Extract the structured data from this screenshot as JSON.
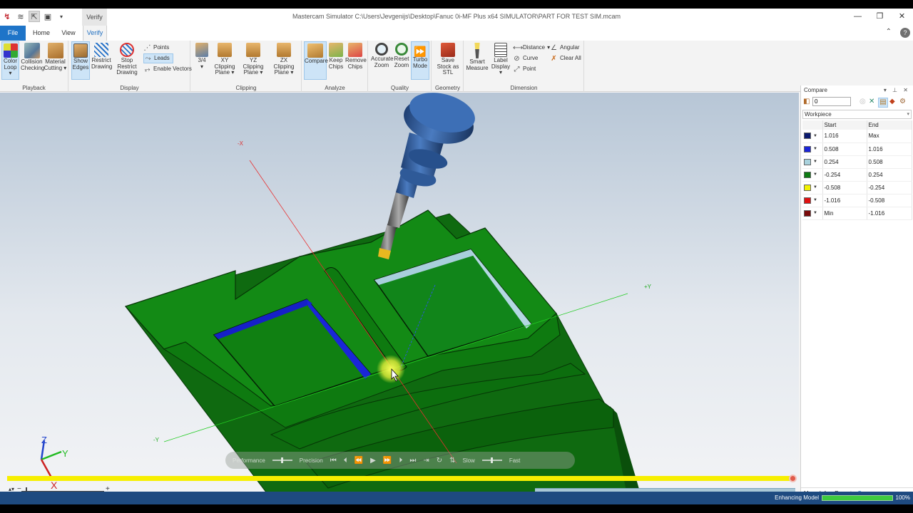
{
  "window": {
    "title": "Mastercam Simulator  C:\\Users\\Jevgenijs\\Desktop\\Fanuc 0i-MF Plus x64 SIMULATOR\\PART FOR TEST SIM.mcam",
    "context_tab": "Verify"
  },
  "tabs": [
    "File",
    "Home",
    "View",
    "Verify"
  ],
  "ribbon": {
    "playback": {
      "title": "Playback",
      "color_loop": "Color Loop",
      "collision": "Collision Checking",
      "material": "Material Cutting"
    },
    "display": {
      "title": "Display",
      "show_edges": "Show Edges",
      "restrict": "Restrict Drawing",
      "stop_restrict": "Stop Restrict Drawing",
      "points": "Points",
      "leads": "Leads",
      "enable_vectors": "Enable Vectors"
    },
    "clipping": {
      "title": "Clipping",
      "three_quarter": "3/4",
      "xy": "XY Clipping Plane",
      "yz": "YZ Clipping Plane",
      "zx": "ZX Clipping Plane"
    },
    "analyze": {
      "title": "Analyze",
      "compare": "Compare",
      "keep": "Keep Chips",
      "remove": "Remove Chips"
    },
    "quality": {
      "title": "Quality",
      "accurate": "Accurate Zoom",
      "reset": "Reset Zoom",
      "turbo": "Turbo Mode"
    },
    "geometry": {
      "title": "Geometry",
      "save_stl": "Save Stock as STL"
    },
    "dimension": {
      "title": "Dimension",
      "smart": "Smart Measure",
      "label": "Label Display",
      "distance": "Distance",
      "curve": "Curve",
      "point": "Point",
      "angular": "Angular",
      "clear_all": "Clear All"
    }
  },
  "viewport": {
    "axis_labels": {
      "neg_x": "-X",
      "pos_y": "+Y",
      "neg_y": "-Y"
    },
    "triad": {
      "z": "Z",
      "y": "Y",
      "x": "X"
    },
    "playbar": {
      "performance": "Performance",
      "precision": "Precision",
      "slow": "Slow",
      "fast": "Fast"
    },
    "timeline_progress": 1.0,
    "zoom": {
      "minus": "−",
      "plus": "+"
    }
  },
  "compare": {
    "title": "Compare",
    "value": "0",
    "select": "Workpiece",
    "col_start": "Start",
    "col_end": "End",
    "rows": [
      {
        "color": "#0b1a6e",
        "start": "1.016",
        "end": "Max"
      },
      {
        "color": "#1a24d8",
        "start": "0.508",
        "end": "1.016"
      },
      {
        "color": "#a9d2dd",
        "start": "0.254",
        "end": "0.508"
      },
      {
        "color": "#0d7a12",
        "start": "-0.254",
        "end": "0.254"
      },
      {
        "color": "#f2f200",
        "start": "-0.508",
        "end": "-0.254"
      },
      {
        "color": "#e01010",
        "start": "-1.016",
        "end": "-0.508"
      },
      {
        "color": "#7a0a0a",
        "start": "Min",
        "end": "-1.016"
      }
    ],
    "tabs": [
      "Move Info",
      "Report",
      "Compare"
    ]
  },
  "status": {
    "label": "Enhancing Model",
    "progress": 1.0,
    "percent": "100%"
  }
}
